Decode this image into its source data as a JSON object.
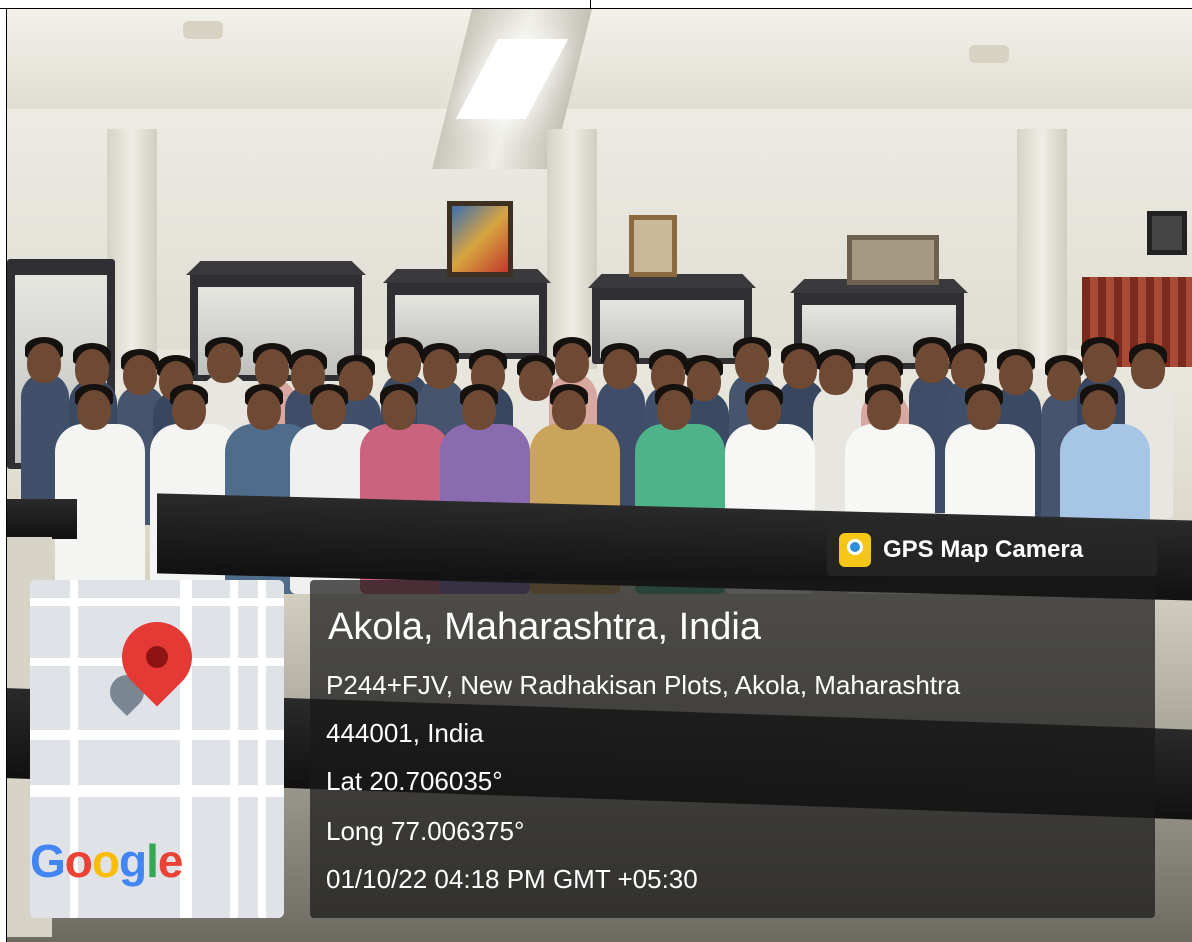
{
  "watermark": {
    "badge_title": "GPS Map Camera",
    "map_logo": "Google",
    "place": "Akola, Maharashtra, India",
    "address_line1": "P244+FJV, New Radhakisan Plots, Akola, Maharashtra",
    "address_line2": "444001, India",
    "lat": "Lat 20.706035°",
    "long": "Long 77.006375°",
    "datetime": "01/10/22 04:18 PM GMT +05:30"
  },
  "colors": {
    "pin_red": "#e53935",
    "google_blue": "#4285f4",
    "google_red": "#ea4335",
    "google_yellow": "#fbbc05",
    "google_green": "#34a853"
  },
  "icons": {
    "badge_icon": "gps-map-camera-icon",
    "map_pin": "location-pin-icon"
  }
}
